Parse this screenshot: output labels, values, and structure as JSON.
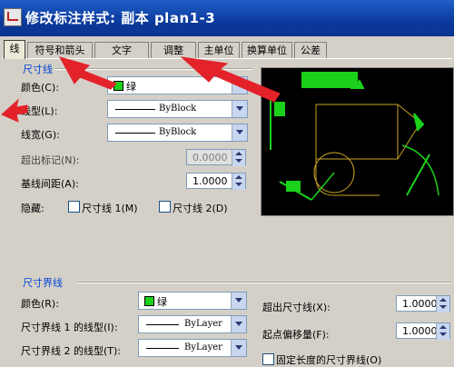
{
  "window": {
    "title": "修改标注样式: 副本 plan1-3"
  },
  "tabs": [
    {
      "label": "线",
      "active": true
    },
    {
      "label": "符号和箭头",
      "active": false
    },
    {
      "label": "文字",
      "active": false
    },
    {
      "label": "调整",
      "active": false
    },
    {
      "label": "主单位",
      "active": false
    },
    {
      "label": "换算单位",
      "active": false
    },
    {
      "label": "公差",
      "active": false
    }
  ],
  "dim_lines": {
    "group_title": "尺寸线",
    "color_label": "颜色(C):",
    "color_value": "绿",
    "linetype_label": "线型(L):",
    "linetype_value": "ByBlock",
    "lineweight_label": "线宽(G):",
    "lineweight_value": "ByBlock",
    "extend_ticks_label": "超出标记(N):",
    "extend_ticks_value": "0.0000",
    "baseline_label": "基线间距(A):",
    "baseline_value": "1.0000",
    "suppress_label": "隐藏:",
    "suppress1_label": "尺寸线 1(M)",
    "suppress2_label": "尺寸线 2(D)"
  },
  "ext_lines": {
    "group_title": "尺寸界线",
    "color_label": "颜色(R):",
    "color_value": "绿",
    "lt1_label": "尺寸界线 1 的线型(I):",
    "lt1_value": "ByLayer",
    "lt2_label": "尺寸界线 2 的线型(T):",
    "lt2_value": "ByLayer",
    "extend_label": "超出尺寸线(X):",
    "extend_value": "1.0000",
    "offset_label": "起点偏移量(F):",
    "offset_value": "1.0000",
    "fixed_label": "固定长度的尺寸界线(O)"
  },
  "colors": {
    "title_bar": "#0b3a9c",
    "accent_blue": "#0046d5",
    "green": "#1bd11b",
    "arrow_red": "#e3222a"
  },
  "icons": [
    "app-icon",
    "dropdown-arrow-icon",
    "spinner-icon",
    "preview-drawing",
    "annotation-arrow"
  ]
}
